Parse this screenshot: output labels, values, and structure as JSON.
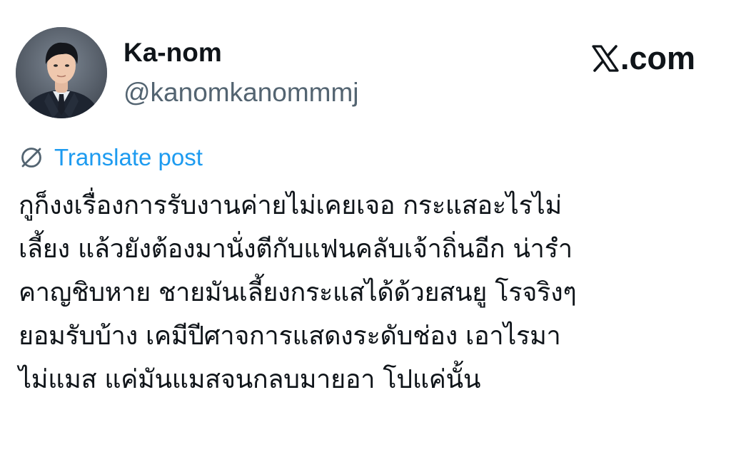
{
  "author": {
    "display_name": "Ka-nom",
    "handle": "@kanomkanommmj",
    "avatar": "profile-photo-man-in-suit"
  },
  "brand": {
    "domain": "𝕏.com",
    "domain_suffix": ".com",
    "logo_icon": "x-logo-icon"
  },
  "translate": {
    "label": "Translate post",
    "icon": "globe-icon",
    "color": "#1d9bf0"
  },
  "post": {
    "lines": [
      "กูก็งงเรื่องการรับงานค่ายไม่เคยเจอ กระแสอะไรไม่",
      "เลี้ยง แล้วยังต้องมานั่งตีกับแฟนคลับเจ้าถิ่นอีก น่ารำ",
      "คาญชิบหาย ชายมันเลี้ยงกระแสได้ด้วยสนยู โรจริงๆ",
      "ยอมรับบ้าง เคมีปีศาจการแสดงระดับช่อง เอาไรมา",
      "ไม่แมส แค่มันแมสจนกลบมายอา โปแค่นั้น"
    ]
  },
  "colors": {
    "text_primary": "#0f1419",
    "text_secondary": "#536471",
    "link": "#1d9bf0",
    "background": "#ffffff"
  }
}
